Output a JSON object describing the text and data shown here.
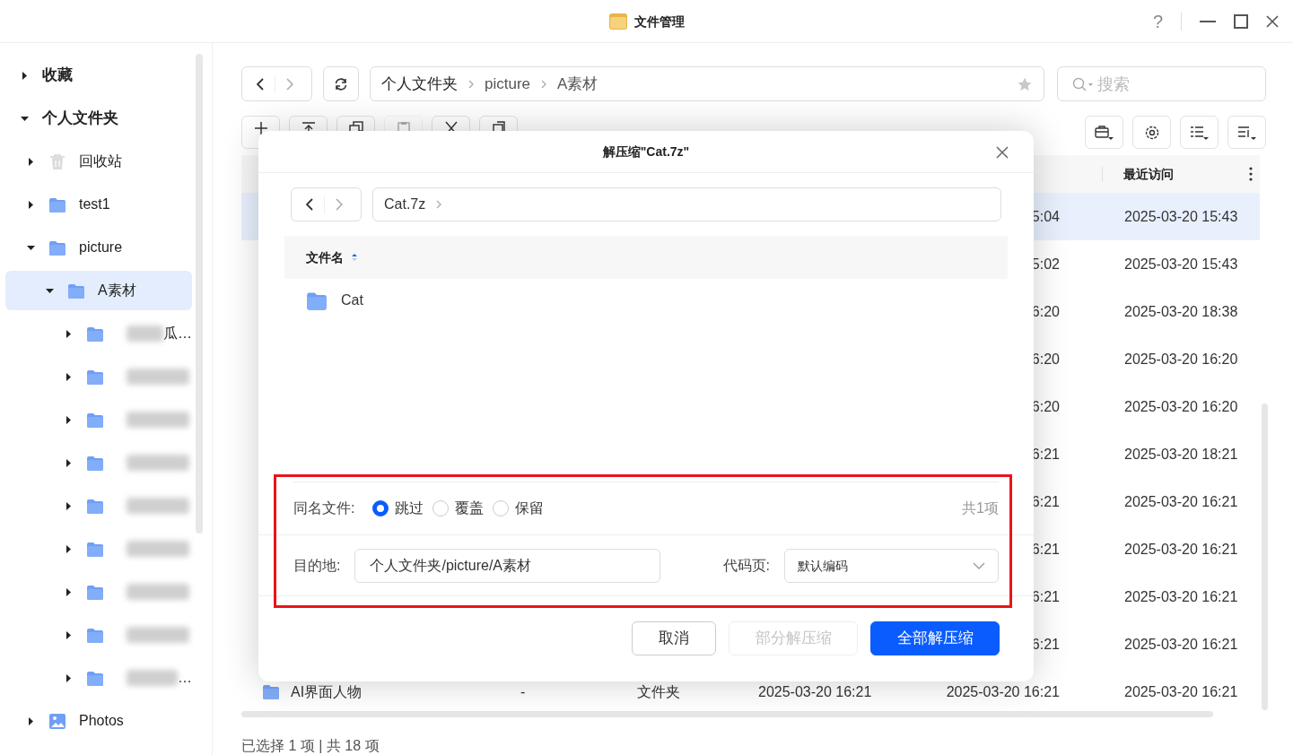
{
  "window": {
    "title": "文件管理",
    "help": "?"
  },
  "sidebar": {
    "items": [
      {
        "kind": "heading",
        "label": "收藏",
        "expanded": false,
        "selected": false
      },
      {
        "kind": "heading",
        "label": "个人文件夹",
        "expanded": true,
        "selected": false,
        "children": [
          {
            "kind": "trash",
            "label": "回收站",
            "expanded": false,
            "selected": false
          },
          {
            "kind": "folder",
            "label": "test1",
            "expanded": false,
            "selected": false
          },
          {
            "kind": "folder",
            "label": "picture",
            "expanded": true,
            "selected": false,
            "children": [
              {
                "kind": "folder",
                "label": "A素材",
                "expanded": true,
                "selected": true,
                "children": [
                  {
                    "kind": "folder",
                    "label": "瓜…",
                    "blurred": true,
                    "expanded": false,
                    "selected": false
                  },
                  {
                    "kind": "folder",
                    "blurred": true,
                    "expanded": false,
                    "selected": false
                  },
                  {
                    "kind": "folder",
                    "blurred": true,
                    "expanded": false,
                    "selected": false
                  },
                  {
                    "kind": "folder",
                    "blurred": true,
                    "expanded": false,
                    "selected": false
                  },
                  {
                    "kind": "folder",
                    "blurred": true,
                    "expanded": false,
                    "selected": false
                  },
                  {
                    "kind": "folder",
                    "blurred": true,
                    "expanded": false,
                    "selected": false
                  },
                  {
                    "kind": "folder",
                    "blurred": true,
                    "expanded": false,
                    "selected": false
                  },
                  {
                    "kind": "folder",
                    "blurred": true,
                    "expanded": false,
                    "selected": false
                  },
                  {
                    "kind": "folder",
                    "label": "…",
                    "blurred": true,
                    "expanded": false,
                    "selected": false
                  }
                ]
              }
            ]
          },
          {
            "kind": "photos",
            "label": "Photos",
            "expanded": false,
            "selected": false
          }
        ]
      }
    ]
  },
  "breadcrumb": [
    "个人文件夹",
    "picture",
    "A素材"
  ],
  "search": {
    "placeholder": "搜索"
  },
  "toolbar": [
    {
      "kind": "plus",
      "disabled": false
    },
    {
      "kind": "upload",
      "disabled": false
    },
    {
      "kind": "copy",
      "disabled": false
    },
    {
      "kind": "paste",
      "disabled": true
    },
    {
      "kind": "cut",
      "disabled": false
    },
    {
      "kind": "move",
      "disabled": false
    }
  ],
  "table": {
    "columns": [
      {
        "label": "最近访问"
      }
    ],
    "rows": [
      {
        "modified": "5:04",
        "accessed": "2025-03-20 15:43",
        "selected": true
      },
      {
        "modified": "5:02",
        "accessed": "2025-03-20 15:43",
        "selected": false
      },
      {
        "modified": "6:20",
        "accessed": "2025-03-20 18:38",
        "selected": false
      },
      {
        "modified": "6:20",
        "accessed": "2025-03-20 16:20",
        "selected": false
      },
      {
        "modified": "6:20",
        "accessed": "2025-03-20 16:20",
        "selected": false
      },
      {
        "modified": "6:21",
        "accessed": "2025-03-20 18:21",
        "selected": false
      },
      {
        "modified": "6:21",
        "accessed": "2025-03-20 16:21",
        "selected": false
      },
      {
        "modified": "6:21",
        "accessed": "2025-03-20 16:21",
        "selected": false
      },
      {
        "modified": "6:21",
        "accessed": "2025-03-20 16:21",
        "selected": false
      },
      {
        "modified": "6:21",
        "accessed": "2025-03-20 16:21",
        "selected": false
      },
      {
        "name": "AI界面人物",
        "size": "-",
        "type": "文件夹",
        "created": "2025-03-20 16:21",
        "modified": "2025-03-20 16:21",
        "accessed": "2025-03-20 16:21",
        "selected": false
      }
    ]
  },
  "status_bar": "已选择 1 项 | 共 18 项",
  "dialog": {
    "title": "解压缩\"Cat.7z\"",
    "path": "Cat.7z",
    "column": "文件名",
    "files": [
      {
        "name": "Cat"
      }
    ],
    "conflict_label": "同名文件:",
    "options": [
      {
        "label": "跳过",
        "selected": true
      },
      {
        "label": "覆盖",
        "selected": false
      },
      {
        "label": "保留",
        "selected": false
      }
    ],
    "count": "共1项",
    "destination_label": "目的地:",
    "destination": "个人文件夹/picture/A素材",
    "codepage_label": "代码页:",
    "codepage": "默认编码",
    "buttons": [
      {
        "label": "取消",
        "kind": "default",
        "disabled": false
      },
      {
        "label": "部分解压缩",
        "kind": "default",
        "disabled": true
      },
      {
        "label": "全部解压缩",
        "kind": "primary",
        "disabled": false
      }
    ]
  }
}
